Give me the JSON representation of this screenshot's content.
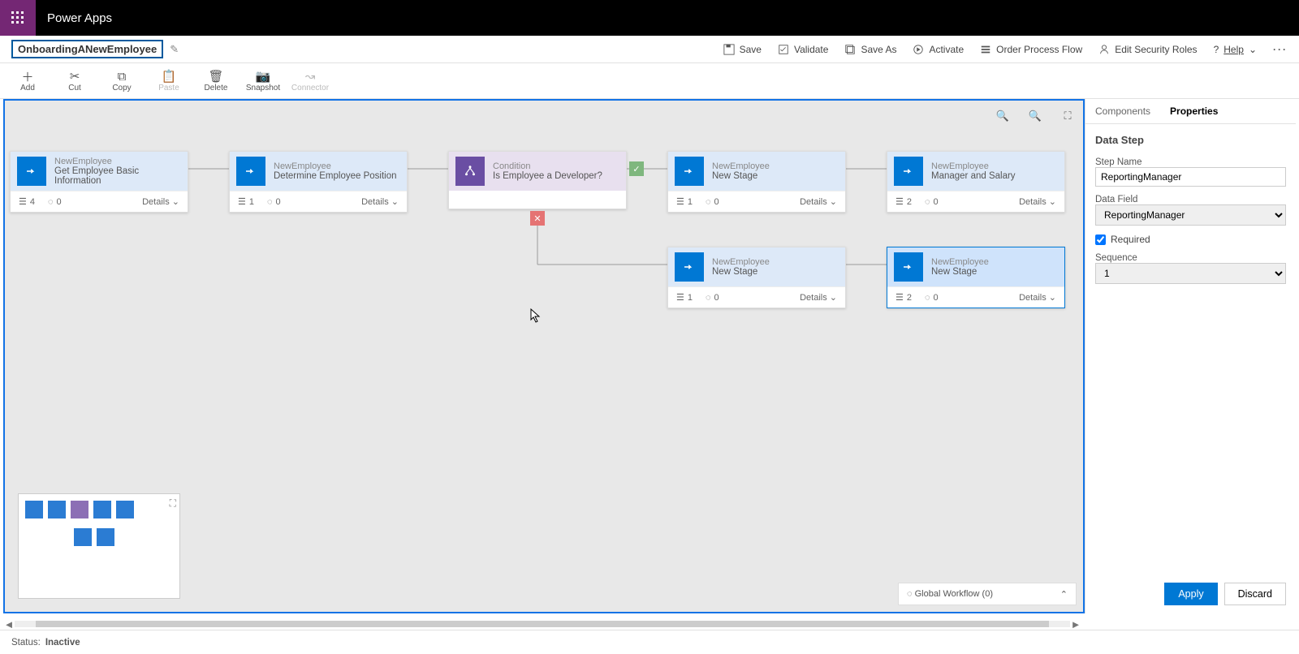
{
  "top": {
    "app_name": "Power Apps"
  },
  "breadcrumb": {
    "title": "OnboardingANewEmployee"
  },
  "cmd": {
    "save": "Save",
    "validate": "Validate",
    "save_as": "Save As",
    "activate": "Activate",
    "order": "Order Process Flow",
    "edit_security": "Edit Security Roles",
    "help": "Help"
  },
  "toolbar": {
    "add": "Add",
    "cut": "Cut",
    "copy": "Copy",
    "paste": "Paste",
    "delete": "Delete",
    "snapshot": "Snapshot",
    "connector": "Connector"
  },
  "stages": {
    "s1": {
      "entity": "NewEmployee",
      "name": "Get Employee Basic Information",
      "steps": "4",
      "triggers": "0",
      "details": "Details"
    },
    "s2": {
      "entity": "NewEmployee",
      "name": "Determine Employee Position",
      "steps": "1",
      "triggers": "0",
      "details": "Details"
    },
    "cond": {
      "entity": "Condition",
      "name": "Is Employee a Developer?"
    },
    "s3": {
      "entity": "NewEmployee",
      "name": "New Stage",
      "steps": "1",
      "triggers": "0",
      "details": "Details"
    },
    "s4": {
      "entity": "NewEmployee",
      "name": "Manager and Salary",
      "steps": "2",
      "triggers": "0",
      "details": "Details"
    },
    "s5": {
      "entity": "NewEmployee",
      "name": "New Stage",
      "steps": "1",
      "triggers": "0",
      "details": "Details"
    },
    "s6": {
      "entity": "NewEmployee",
      "name": "New Stage",
      "steps": "2",
      "triggers": "0",
      "details": "Details"
    }
  },
  "globalwf": {
    "label": "Global Workflow (0)"
  },
  "panel": {
    "tab_components": "Components",
    "tab_properties": "Properties",
    "section_title": "Data Step",
    "step_name_label": "Step Name",
    "step_name_value": "ReportingManager",
    "data_field_label": "Data Field",
    "data_field_value": "ReportingManager",
    "required_label": "Required",
    "required_checked": true,
    "sequence_label": "Sequence",
    "sequence_value": "1",
    "apply": "Apply",
    "discard": "Discard"
  },
  "status": {
    "label": "Status:",
    "value": "Inactive"
  }
}
